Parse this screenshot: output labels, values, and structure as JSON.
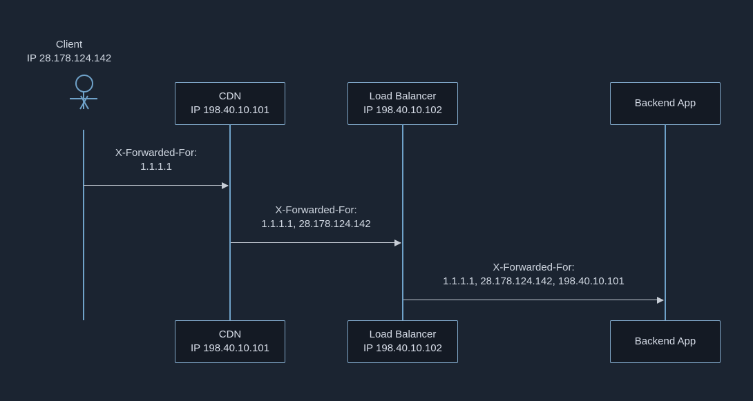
{
  "client": {
    "label_line1": "Client",
    "label_line2": "IP 28.178.124.142"
  },
  "nodes": {
    "cdn": {
      "name": "CDN",
      "ip": "IP 198.40.10.101"
    },
    "lb": {
      "name": "Load Balancer",
      "ip": "IP 198.40.10.102"
    },
    "backend": {
      "name": "Backend App"
    }
  },
  "messages": {
    "m1": {
      "header": "X-Forwarded-For:",
      "value": "1.1.1.1"
    },
    "m2": {
      "header": "X-Forwarded-For:",
      "value": "1.1.1.1, 28.178.124.142"
    },
    "m3": {
      "header": "X-Forwarded-For:",
      "value": "1.1.1.1, 28.178.124.142, 198.40.10.101"
    }
  },
  "chart_data": {
    "type": "sequence-diagram",
    "participants": [
      {
        "id": "client",
        "label": "Client",
        "ip": "28.178.124.142"
      },
      {
        "id": "cdn",
        "label": "CDN",
        "ip": "198.40.10.101"
      },
      {
        "id": "lb",
        "label": "Load Balancer",
        "ip": "198.40.10.102"
      },
      {
        "id": "backend",
        "label": "Backend App"
      }
    ],
    "messages": [
      {
        "from": "client",
        "to": "cdn",
        "header": "X-Forwarded-For",
        "value": "1.1.1.1"
      },
      {
        "from": "cdn",
        "to": "lb",
        "header": "X-Forwarded-For",
        "value": "1.1.1.1, 28.178.124.142"
      },
      {
        "from": "lb",
        "to": "backend",
        "header": "X-Forwarded-For",
        "value": "1.1.1.1, 28.178.124.142, 198.40.10.101"
      }
    ]
  }
}
